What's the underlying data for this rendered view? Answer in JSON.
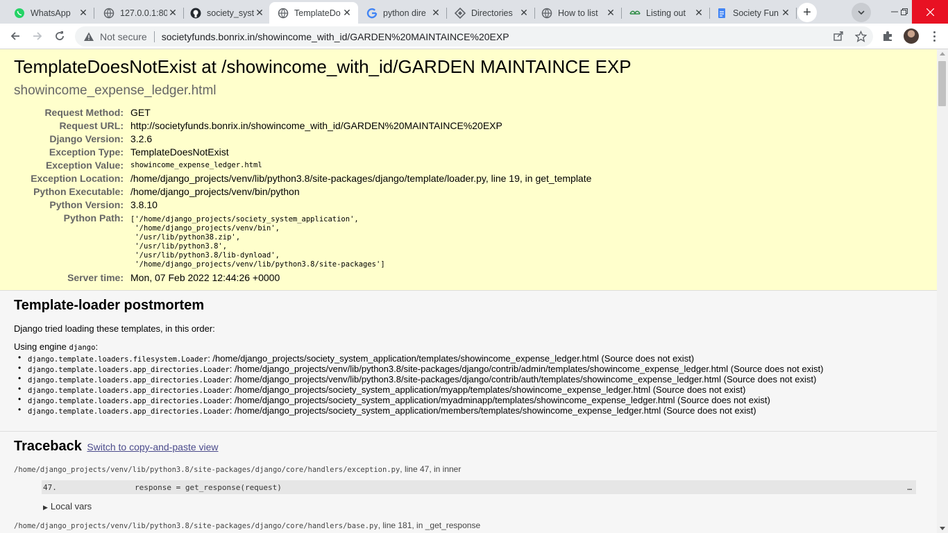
{
  "browser": {
    "tabs": [
      {
        "title": "WhatsApp",
        "icon": "whatsapp-icon",
        "color": "#25d366"
      },
      {
        "title": "127.0.0.1:80",
        "icon": "globe-icon",
        "color": "#5f6368"
      },
      {
        "title": "society_syst",
        "icon": "github-icon",
        "color": "#24292f"
      },
      {
        "title": "TemplateDo",
        "icon": "globe-icon",
        "color": "#5f6368",
        "active": true
      },
      {
        "title": "python dire",
        "icon": "google-icon",
        "color": "#4285f4"
      },
      {
        "title": "Directories",
        "icon": "diamond-icon",
        "color": "#5f6368"
      },
      {
        "title": "How to list",
        "icon": "globe-icon",
        "color": "#5f6368"
      },
      {
        "title": "Listing out",
        "icon": "geeks-icon",
        "color": "#2f8d46"
      },
      {
        "title": "Society Fun",
        "icon": "docs-icon",
        "color": "#4285f4"
      }
    ],
    "address": {
      "security_label": "Not secure",
      "url": "societyfunds.bonrix.in/showincome_with_id/GARDEN%20MAINTAINCE%20EXP"
    }
  },
  "error": {
    "title": "TemplateDoesNotExist at /showincome_with_id/GARDEN MAINTAINCE EXP",
    "subtitle": "showincome_expense_ledger.html",
    "meta": [
      {
        "label": "Request Method:",
        "value": "GET"
      },
      {
        "label": "Request URL:",
        "value": "http://societyfunds.bonrix.in/showincome_with_id/GARDEN%20MAINTAINCE%20EXP"
      },
      {
        "label": "Django Version:",
        "value": "3.2.6"
      },
      {
        "label": "Exception Type:",
        "value": "TemplateDoesNotExist"
      },
      {
        "label": "Exception Value:",
        "value": "showincome_expense_ledger.html"
      },
      {
        "label": "Exception Location:",
        "value": "/home/django_projects/venv/lib/python3.8/site-packages/django/template/loader.py, line 19, in get_template"
      },
      {
        "label": "Python Executable:",
        "value": "/home/django_projects/venv/bin/python"
      },
      {
        "label": "Python Version:",
        "value": "3.8.10"
      },
      {
        "label": "Python Path:",
        "value": "['/home/django_projects/society_system_application',\n '/home/django_projects/venv/bin',\n '/usr/lib/python38.zip',\n '/usr/lib/python3.8',\n '/usr/lib/python3.8/lib-dynload',\n '/home/django_projects/venv/lib/python3.8/site-packages']"
      },
      {
        "label": "Server time:",
        "value": "Mon, 07 Feb 2022 12:44:26 +0000"
      }
    ]
  },
  "postmortem": {
    "heading": "Template-loader postmortem",
    "intro": "Django tried loading these templates, in this order:",
    "engine_prefix": "Using engine ",
    "engine_name": "django",
    "engine_suffix": ":",
    "attempts": [
      {
        "loader": "django.template.loaders.filesystem.Loader",
        "path": "/home/django_projects/society_system_application/templates/showincome_expense_ledger.html (Source does not exist)"
      },
      {
        "loader": "django.template.loaders.app_directories.Loader",
        "path": "/home/django_projects/venv/lib/python3.8/site-packages/django/contrib/admin/templates/showincome_expense_ledger.html (Source does not exist)"
      },
      {
        "loader": "django.template.loaders.app_directories.Loader",
        "path": "/home/django_projects/venv/lib/python3.8/site-packages/django/contrib/auth/templates/showincome_expense_ledger.html (Source does not exist)"
      },
      {
        "loader": "django.template.loaders.app_directories.Loader",
        "path": "/home/django_projects/society_system_application/myapp/templates/showincome_expense_ledger.html (Source does not exist)"
      },
      {
        "loader": "django.template.loaders.app_directories.Loader",
        "path": "/home/django_projects/society_system_application/myadminapp/templates/showincome_expense_ledger.html (Source does not exist)"
      },
      {
        "loader": "django.template.loaders.app_directories.Loader",
        "path": "/home/django_projects/society_system_application/members/templates/showincome_expense_ledger.html (Source does not exist)"
      }
    ]
  },
  "traceback": {
    "heading": "Traceback",
    "switch_link": "Switch to copy-and-paste view",
    "frames": [
      {
        "file": "/home/django_projects/venv/lib/python3.8/site-packages/django/core/handlers/exception.py",
        "suffix": ", line 47, in inner",
        "line_no": "47.",
        "code": "response = get_response(request)",
        "ellipsis": "…",
        "local_vars": "Local vars"
      },
      {
        "file": "/home/django_projects/venv/lib/python3.8/site-packages/django/core/handlers/base.py",
        "suffix": ", line 181, in _get_response"
      }
    ]
  }
}
